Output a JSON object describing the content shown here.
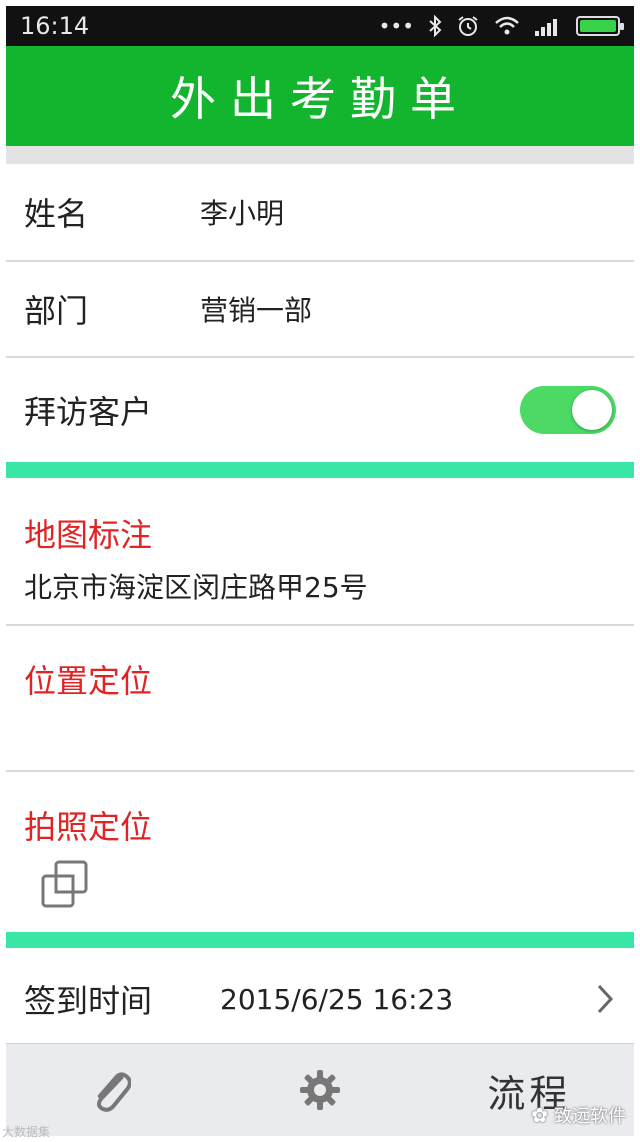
{
  "status_bar": {
    "time": "16:14",
    "icons": [
      "dots-icon",
      "bluetooth-icon",
      "alarm-icon",
      "wifi-icon",
      "signal-icon",
      "battery-icon"
    ]
  },
  "header": {
    "title": "外出考勤单"
  },
  "form": {
    "name": {
      "label": "姓名",
      "value": "李小明"
    },
    "department": {
      "label": "部门",
      "value": "营销一部"
    },
    "visit_client": {
      "label": "拜访客户",
      "enabled": true
    }
  },
  "sections": {
    "map": {
      "title": "地图标注",
      "address": "北京市海淀区闵庄路甲25号"
    },
    "location": {
      "title": "位置定位"
    },
    "photo": {
      "title": "拍照定位",
      "icon": "copy-photo-icon"
    }
  },
  "checkin": {
    "label": "签到时间",
    "value": "2015/6/25 16:23",
    "icon": "chevron-right-icon"
  },
  "footer": {
    "attach_icon": "paperclip-icon",
    "settings_icon": "gear-icon",
    "flow_label": "流程"
  },
  "watermarks": {
    "left": "大数据集",
    "right": "致远软件"
  },
  "colors": {
    "header": "#14b52e",
    "accent_band": "#3ae6a6",
    "section_title": "#e02424",
    "toggle_on": "#4cd964"
  }
}
